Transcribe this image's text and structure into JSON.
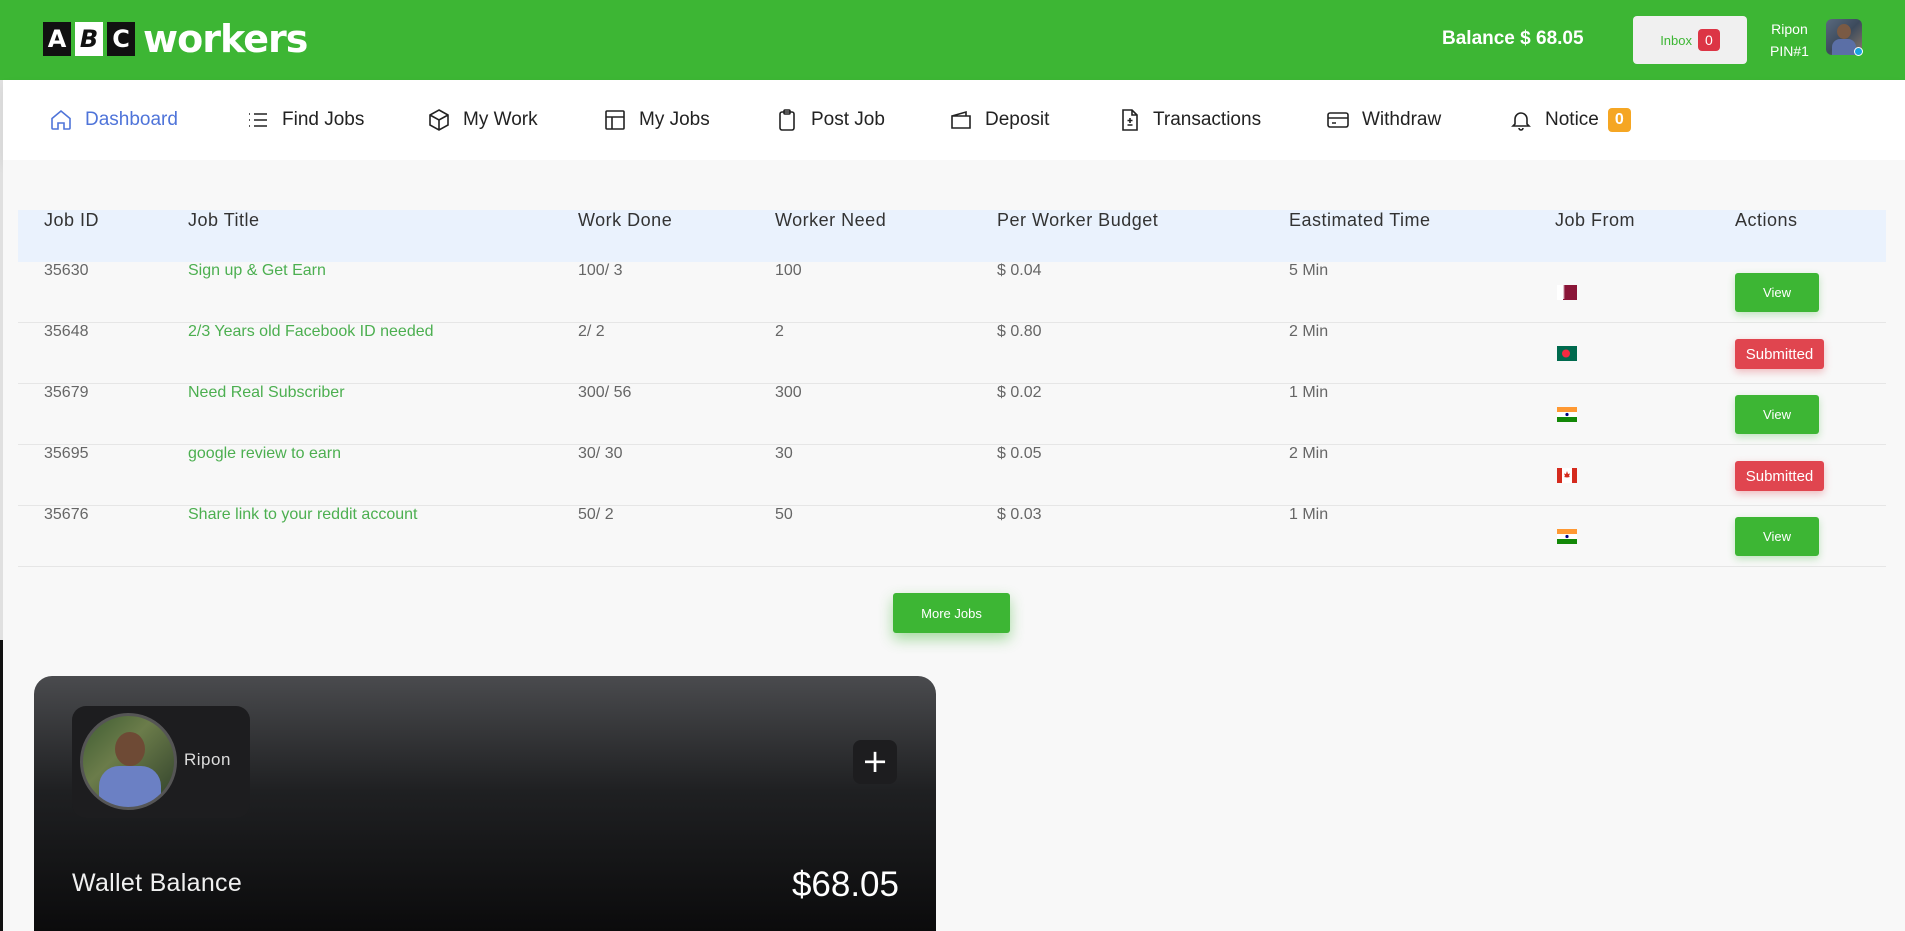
{
  "header": {
    "logo_letters": [
      "A",
      "B",
      "C"
    ],
    "logo_word": "workers",
    "balance": "Balance $ 68.05",
    "inbox_label": "Inbox",
    "inbox_count": "0",
    "user_name": "Ripon",
    "user_pin": "PIN#1"
  },
  "nav": {
    "items": [
      {
        "label": "Dashboard",
        "icon": "home-icon"
      },
      {
        "label": "Find Jobs",
        "icon": "list-icon"
      },
      {
        "label": "My Work",
        "icon": "box-icon"
      },
      {
        "label": "My Jobs",
        "icon": "layout-icon"
      },
      {
        "label": "Post Job",
        "icon": "clipboard-icon"
      },
      {
        "label": "Deposit",
        "icon": "wallet-icon"
      },
      {
        "label": "Transactions",
        "icon": "file-plus-minus-icon"
      },
      {
        "label": "Withdraw",
        "icon": "credit-card-icon"
      },
      {
        "label": "Notice",
        "icon": "bell-icon"
      }
    ],
    "notice_count": "0"
  },
  "table": {
    "headers": [
      "Job ID",
      "Job Title",
      "Work Done",
      "Worker Need",
      "Per Worker Budget",
      "Eastimated Time",
      "Job From",
      "Actions"
    ],
    "rows": [
      {
        "id": "35630",
        "title": "Sign up & Get Earn",
        "work_done": "100/ 3",
        "worker_need": "100",
        "budget": "$ 0.04",
        "time": "5 Min",
        "flag": "qatar",
        "action": "View"
      },
      {
        "id": "35648",
        "title": "2/3 Years old Facebook ID needed",
        "work_done": "2/ 2",
        "worker_need": "2",
        "budget": "$ 0.80",
        "time": "2 Min",
        "flag": "bangladesh",
        "action": "Submitted"
      },
      {
        "id": "35679",
        "title": "Need Real Subscriber",
        "work_done": "300/ 56",
        "worker_need": "300",
        "budget": "$ 0.02",
        "time": "1 Min",
        "flag": "india",
        "action": "View"
      },
      {
        "id": "35695",
        "title": "google review to earn",
        "work_done": "30/ 30",
        "worker_need": "30",
        "budget": "$ 0.05",
        "time": "2 Min",
        "flag": "canada",
        "action": "Submitted"
      },
      {
        "id": "35676",
        "title": "Share link to your reddit account",
        "work_done": "50/ 2",
        "worker_need": "50",
        "budget": "$ 0.03",
        "time": "1 Min",
        "flag": "india",
        "action": "View"
      }
    ]
  },
  "more_jobs_label": "More Jobs",
  "wallet": {
    "user_name": "Ripon",
    "plus_label": "+",
    "label": "Wallet Balance",
    "amount": "$68.05"
  },
  "colors": {
    "brand_green": "#3db634",
    "active_nav": "#4f74d9",
    "danger_red": "#e0454f",
    "notice_orange": "#f5a623",
    "table_header_bg": "#eaf2fd"
  }
}
